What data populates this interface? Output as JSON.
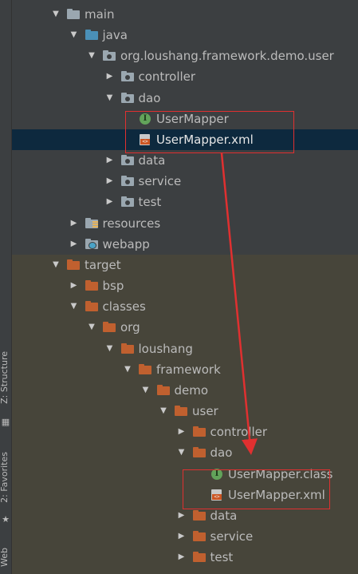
{
  "side_tabs": {
    "structure": "Z: Structure",
    "favorites": "2: Favorites",
    "web": "Web"
  },
  "tree": {
    "source": [
      {
        "label": "main",
        "icon": "folder-gray",
        "arrow": "down"
      },
      {
        "label": "java",
        "icon": "folder-blue",
        "arrow": "down"
      },
      {
        "label": "org.loushang.framework.demo.user",
        "icon": "folder-pkg",
        "arrow": "down"
      },
      {
        "label": "controller",
        "icon": "folder-pkg",
        "arrow": "right"
      },
      {
        "label": "dao",
        "icon": "folder-pkg",
        "arrow": "down"
      },
      {
        "label": "UserMapper",
        "icon": "interface-icon",
        "arrow": "none"
      },
      {
        "label": "UserMapper.xml",
        "icon": "xml-file-icon",
        "arrow": "none",
        "selected": true
      },
      {
        "label": "data",
        "icon": "folder-pkg",
        "arrow": "right"
      },
      {
        "label": "service",
        "icon": "folder-pkg",
        "arrow": "right"
      },
      {
        "label": "test",
        "icon": "folder-pkg",
        "arrow": "right"
      },
      {
        "label": "resources",
        "icon": "folder-res",
        "arrow": "right"
      },
      {
        "label": "webapp",
        "icon": "folder-web",
        "arrow": "right"
      }
    ],
    "target": [
      {
        "label": "target",
        "icon": "folder-orange",
        "arrow": "down"
      },
      {
        "label": "bsp",
        "icon": "folder-orange",
        "arrow": "right"
      },
      {
        "label": "classes",
        "icon": "folder-orange",
        "arrow": "down"
      },
      {
        "label": "org",
        "icon": "folder-orange",
        "arrow": "down"
      },
      {
        "label": "loushang",
        "icon": "folder-orange",
        "arrow": "down"
      },
      {
        "label": "framework",
        "icon": "folder-orange",
        "arrow": "down"
      },
      {
        "label": "demo",
        "icon": "folder-orange",
        "arrow": "down"
      },
      {
        "label": "user",
        "icon": "folder-orange",
        "arrow": "down"
      },
      {
        "label": "controller",
        "icon": "folder-orange",
        "arrow": "right"
      },
      {
        "label": "dao",
        "icon": "folder-orange",
        "arrow": "down"
      },
      {
        "label": "UserMapper.class",
        "icon": "interface-icon",
        "arrow": "none"
      },
      {
        "label": "UserMapper.xml",
        "icon": "xml-file-icon",
        "arrow": "none"
      },
      {
        "label": "data",
        "icon": "folder-orange",
        "arrow": "right"
      },
      {
        "label": "service",
        "icon": "folder-orange",
        "arrow": "right"
      },
      {
        "label": "test",
        "icon": "folder-orange",
        "arrow": "right"
      }
    ]
  },
  "colors": {
    "background": "#3c3f41",
    "target_background": "#47453a",
    "selection": "#0d293e",
    "annotation": "#e03030"
  }
}
